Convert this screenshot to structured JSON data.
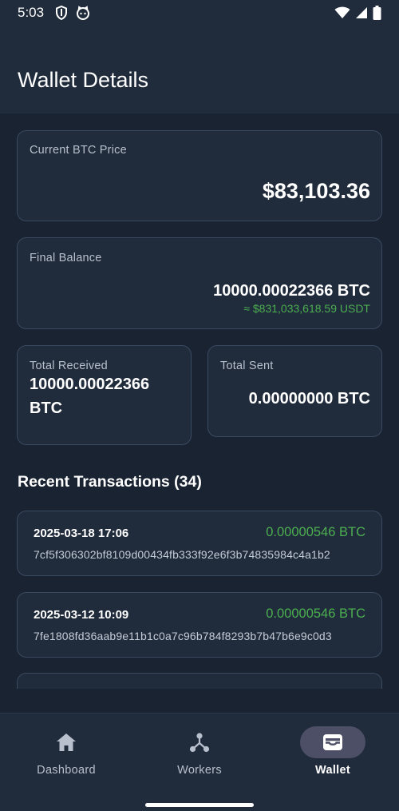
{
  "status_bar": {
    "time": "5:03",
    "icons": [
      "shield-icon",
      "cat-face-icon",
      "wifi-icon",
      "signal-icon",
      "battery-icon"
    ]
  },
  "app_bar": {
    "title": "Wallet Details"
  },
  "price_card": {
    "label": "Current BTC Price",
    "value": "$83,103.36"
  },
  "balance_card": {
    "label": "Final Balance",
    "value": "10000.00022366 BTC",
    "usdt": "≈ $831,033,618.59 USDT"
  },
  "received_card": {
    "label": "Total Received",
    "value": "10000.00022366 BTC"
  },
  "sent_card": {
    "label": "Total Sent",
    "value": "0.00000000 BTC"
  },
  "transactions": {
    "title": "Recent Transactions (34)",
    "items": [
      {
        "date": "2025-03-18 17:06",
        "amount": "0.00000546 BTC",
        "hash": "7cf5f306302bf8109d00434fb333f92e6f3b74835984c4a1b2"
      },
      {
        "date": "2025-03-12 10:09",
        "amount": "0.00000546 BTC",
        "hash": "7fe1808fd36aab9e11b1c0a7c96b784f8293b7b47b6e9c0d3"
      }
    ]
  },
  "bottom_nav": {
    "items": [
      {
        "label": "Dashboard",
        "icon": "home-icon"
      },
      {
        "label": "Workers",
        "icon": "network-icon"
      },
      {
        "label": "Wallet",
        "icon": "wallet-icon"
      }
    ],
    "active": "Wallet"
  },
  "colors": {
    "background": "#1a2332",
    "surface": "#202b3b",
    "card_border": "#3a4a60",
    "positive": "#4caf50",
    "nav_active_pill": "#4d4f66"
  }
}
